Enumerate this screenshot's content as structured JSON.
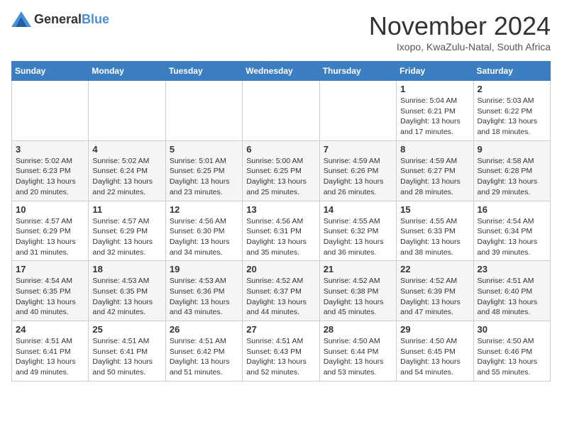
{
  "logo": {
    "text_general": "General",
    "text_blue": "Blue"
  },
  "title": "November 2024",
  "location": "Ixopo, KwaZulu-Natal, South Africa",
  "days_of_week": [
    "Sunday",
    "Monday",
    "Tuesday",
    "Wednesday",
    "Thursday",
    "Friday",
    "Saturday"
  ],
  "weeks": [
    [
      {
        "day": "",
        "info": ""
      },
      {
        "day": "",
        "info": ""
      },
      {
        "day": "",
        "info": ""
      },
      {
        "day": "",
        "info": ""
      },
      {
        "day": "",
        "info": ""
      },
      {
        "day": "1",
        "info": "Sunrise: 5:04 AM\nSunset: 6:21 PM\nDaylight: 13 hours and 17 minutes."
      },
      {
        "day": "2",
        "info": "Sunrise: 5:03 AM\nSunset: 6:22 PM\nDaylight: 13 hours and 18 minutes."
      }
    ],
    [
      {
        "day": "3",
        "info": "Sunrise: 5:02 AM\nSunset: 6:23 PM\nDaylight: 13 hours and 20 minutes."
      },
      {
        "day": "4",
        "info": "Sunrise: 5:02 AM\nSunset: 6:24 PM\nDaylight: 13 hours and 22 minutes."
      },
      {
        "day": "5",
        "info": "Sunrise: 5:01 AM\nSunset: 6:25 PM\nDaylight: 13 hours and 23 minutes."
      },
      {
        "day": "6",
        "info": "Sunrise: 5:00 AM\nSunset: 6:25 PM\nDaylight: 13 hours and 25 minutes."
      },
      {
        "day": "7",
        "info": "Sunrise: 4:59 AM\nSunset: 6:26 PM\nDaylight: 13 hours and 26 minutes."
      },
      {
        "day": "8",
        "info": "Sunrise: 4:59 AM\nSunset: 6:27 PM\nDaylight: 13 hours and 28 minutes."
      },
      {
        "day": "9",
        "info": "Sunrise: 4:58 AM\nSunset: 6:28 PM\nDaylight: 13 hours and 29 minutes."
      }
    ],
    [
      {
        "day": "10",
        "info": "Sunrise: 4:57 AM\nSunset: 6:29 PM\nDaylight: 13 hours and 31 minutes."
      },
      {
        "day": "11",
        "info": "Sunrise: 4:57 AM\nSunset: 6:29 PM\nDaylight: 13 hours and 32 minutes."
      },
      {
        "day": "12",
        "info": "Sunrise: 4:56 AM\nSunset: 6:30 PM\nDaylight: 13 hours and 34 minutes."
      },
      {
        "day": "13",
        "info": "Sunrise: 4:56 AM\nSunset: 6:31 PM\nDaylight: 13 hours and 35 minutes."
      },
      {
        "day": "14",
        "info": "Sunrise: 4:55 AM\nSunset: 6:32 PM\nDaylight: 13 hours and 36 minutes."
      },
      {
        "day": "15",
        "info": "Sunrise: 4:55 AM\nSunset: 6:33 PM\nDaylight: 13 hours and 38 minutes."
      },
      {
        "day": "16",
        "info": "Sunrise: 4:54 AM\nSunset: 6:34 PM\nDaylight: 13 hours and 39 minutes."
      }
    ],
    [
      {
        "day": "17",
        "info": "Sunrise: 4:54 AM\nSunset: 6:35 PM\nDaylight: 13 hours and 40 minutes."
      },
      {
        "day": "18",
        "info": "Sunrise: 4:53 AM\nSunset: 6:35 PM\nDaylight: 13 hours and 42 minutes."
      },
      {
        "day": "19",
        "info": "Sunrise: 4:53 AM\nSunset: 6:36 PM\nDaylight: 13 hours and 43 minutes."
      },
      {
        "day": "20",
        "info": "Sunrise: 4:52 AM\nSunset: 6:37 PM\nDaylight: 13 hours and 44 minutes."
      },
      {
        "day": "21",
        "info": "Sunrise: 4:52 AM\nSunset: 6:38 PM\nDaylight: 13 hours and 45 minutes."
      },
      {
        "day": "22",
        "info": "Sunrise: 4:52 AM\nSunset: 6:39 PM\nDaylight: 13 hours and 47 minutes."
      },
      {
        "day": "23",
        "info": "Sunrise: 4:51 AM\nSunset: 6:40 PM\nDaylight: 13 hours and 48 minutes."
      }
    ],
    [
      {
        "day": "24",
        "info": "Sunrise: 4:51 AM\nSunset: 6:41 PM\nDaylight: 13 hours and 49 minutes."
      },
      {
        "day": "25",
        "info": "Sunrise: 4:51 AM\nSunset: 6:41 PM\nDaylight: 13 hours and 50 minutes."
      },
      {
        "day": "26",
        "info": "Sunrise: 4:51 AM\nSunset: 6:42 PM\nDaylight: 13 hours and 51 minutes."
      },
      {
        "day": "27",
        "info": "Sunrise: 4:51 AM\nSunset: 6:43 PM\nDaylight: 13 hours and 52 minutes."
      },
      {
        "day": "28",
        "info": "Sunrise: 4:50 AM\nSunset: 6:44 PM\nDaylight: 13 hours and 53 minutes."
      },
      {
        "day": "29",
        "info": "Sunrise: 4:50 AM\nSunset: 6:45 PM\nDaylight: 13 hours and 54 minutes."
      },
      {
        "day": "30",
        "info": "Sunrise: 4:50 AM\nSunset: 6:46 PM\nDaylight: 13 hours and 55 minutes."
      }
    ]
  ]
}
